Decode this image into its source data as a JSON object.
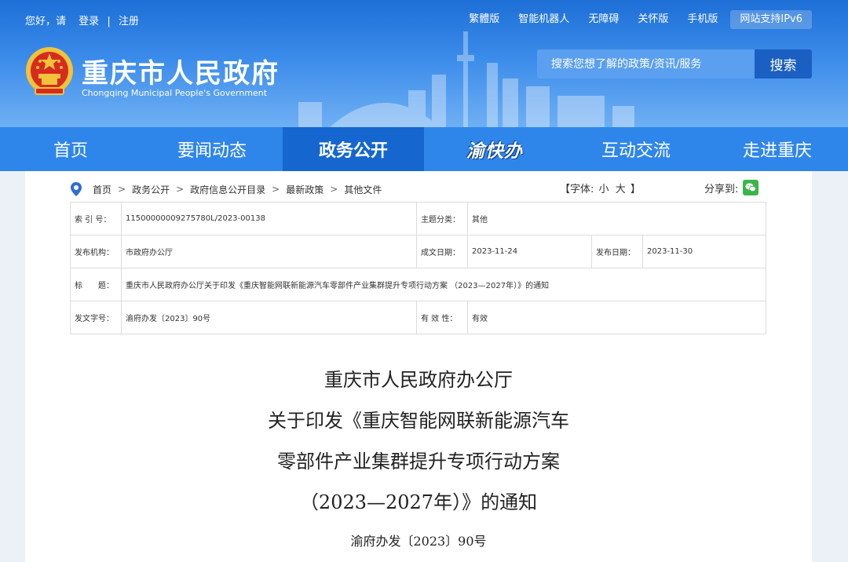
{
  "topbar": {
    "greeting": "您好，请",
    "login": "登录",
    "divider": "|",
    "register": "注册",
    "links": [
      "繁體版",
      "智能机器人",
      "无障碍",
      "关怀版",
      "手机版"
    ],
    "ipv6": "网站支持IPv6"
  },
  "site": {
    "title": "重庆市人民政府",
    "subtitle": "Chongqing Municipal People's Government"
  },
  "search": {
    "placeholder": "搜索您想了解的政策/资讯/服务",
    "button": "搜索"
  },
  "nav": {
    "items": [
      "首页",
      "要闻动态",
      "政务公开",
      "渝快办",
      "互动交流",
      "走进重庆"
    ],
    "active": "政务公开"
  },
  "breadcrumb": {
    "items": [
      "首页",
      "政务公开",
      "政府信息公开目录",
      "最新政策",
      "其他文件"
    ],
    "separator": ">"
  },
  "font_size": {
    "open": "【字体:",
    "small": "小",
    "large": "大",
    "close": "】"
  },
  "share": {
    "label": "分享到:",
    "icon": "wechat-icon"
  },
  "meta": {
    "index_label": "索 引 号：",
    "index_value": "11500000009275780L/2023-00138",
    "category_label": "主题分类：",
    "category_value": "其他",
    "publisher_label": "发布机构：",
    "publisher_value": "市政府办公厅",
    "created_label": "成文日期：",
    "created_value": "2023-11-24",
    "published_label": "发布日期：",
    "published_value": "2023-11-30",
    "title_label": "标　　题：",
    "title_value": "重庆市人民政府办公厅关于印发《重庆智能网联新能源汽车零部件产业集群提升专项行动方案 （2023—2027年）》的通知",
    "docno_label": "发文字号：",
    "docno_value": "渝府办发〔2023〕90号",
    "validity_label": "有 效 性：",
    "validity_value": "有效"
  },
  "document": {
    "title_lines": [
      "重庆市人民政府办公厅",
      "关于印发《重庆智能网联新能源汽车",
      "零部件产业集群提升专项行动方案",
      "（2023—2027年）》的通知"
    ],
    "doc_number": "渝府办发〔2023〕90号"
  },
  "colors": {
    "header_top": "#1e6fd6",
    "nav_bg": "#2f86ea",
    "nav_active": "#1566cf",
    "search_button": "#1b5fc2",
    "wechat": "#3bb54a"
  }
}
